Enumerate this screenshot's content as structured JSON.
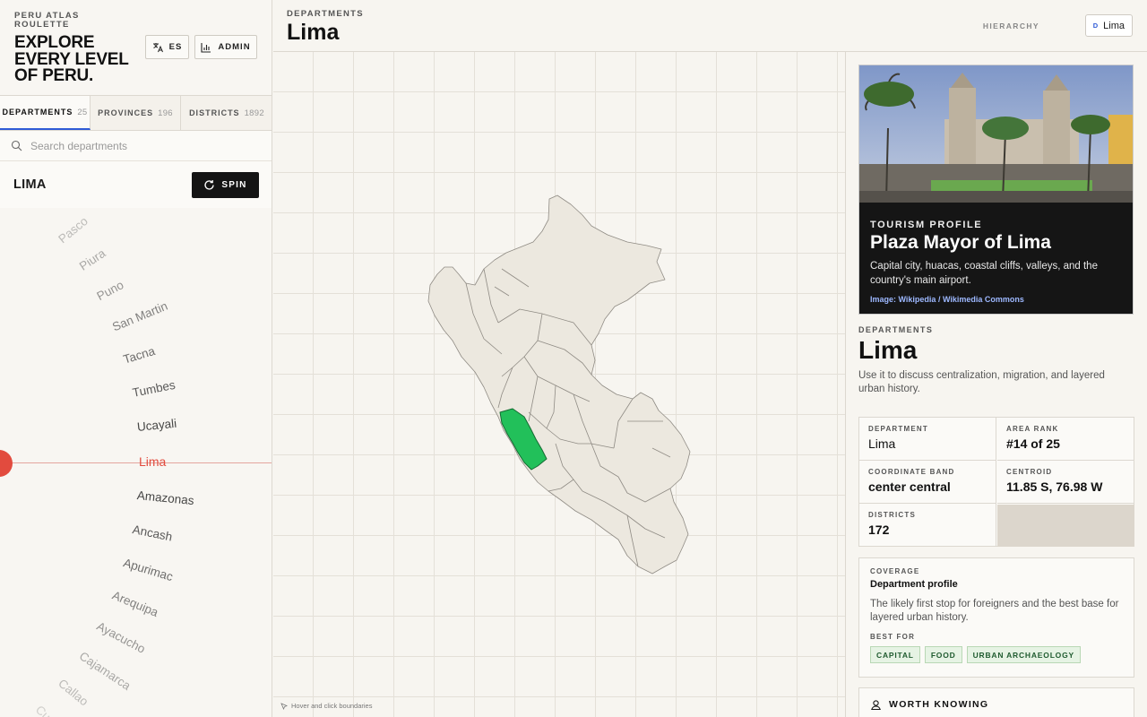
{
  "brand": {
    "kicker": "PERU ATLAS ROULETTE",
    "title": "EXPLORE EVERY LEVEL OF PERU."
  },
  "header_buttons": {
    "language": "ES",
    "admin": "ADMIN"
  },
  "tabs": [
    {
      "label": "DEPARTMENTS",
      "count": "25",
      "active": true
    },
    {
      "label": "PROVINCES",
      "count": "196",
      "active": false
    },
    {
      "label": "DISTRICTS",
      "count": "1892",
      "active": false
    }
  ],
  "search": {
    "placeholder": "Search departments",
    "value": ""
  },
  "current": {
    "name": "LIMA",
    "spin_label": "SPIN"
  },
  "wheel": {
    "selected": "Lima",
    "items": [
      "Pasco",
      "Piura",
      "Puno",
      "San Martin",
      "Tacna",
      "Tumbes",
      "Ucayali",
      "Lima",
      "Amazonas",
      "Ancash",
      "Apurimac",
      "Arequipa",
      "Ayacucho",
      "Cajamarca",
      "Callao",
      "Cusco"
    ]
  },
  "center": {
    "breadcrumb": "DEPARTMENTS",
    "title": "Lima",
    "hierarchy_label": "HIERARCHY",
    "hierarchy_badge": "D",
    "hierarchy_value": "Lima",
    "map_hint": "Hover and click boundaries",
    "highlight_color": "#22c05a"
  },
  "tourism": {
    "kicker": "TOURISM PROFILE",
    "title": "Plaza Mayor of Lima",
    "description": "Capital city, huacas, coastal cliffs, valleys, and the country's main airport.",
    "credit": "Image: Wikipedia / Wikimedia Commons"
  },
  "department": {
    "kicker": "DEPARTMENTS",
    "title": "Lima",
    "description": "Use it to discuss centralization, migration, and layered urban history."
  },
  "stats": {
    "department": {
      "label": "DEPARTMENT",
      "value": "Lima"
    },
    "area_rank": {
      "label": "AREA RANK",
      "value": "#14 of 25"
    },
    "coordinate_band": {
      "label": "COORDINATE BAND",
      "value": "center central"
    },
    "centroid": {
      "label": "CENTROID",
      "value": "11.85 S, 76.98 W"
    },
    "districts": {
      "label": "DISTRICTS",
      "value": "172"
    }
  },
  "coverage": {
    "kicker": "COVERAGE",
    "title": "Department profile",
    "description": "The likely first stop for foreigners and the best base for layered urban history.",
    "best_for_label": "BEST FOR",
    "tags": [
      "CAPITAL",
      "FOOD",
      "URBAN ARCHAEOLOGY"
    ]
  },
  "worth_knowing": {
    "label": "WORTH KNOWING"
  }
}
